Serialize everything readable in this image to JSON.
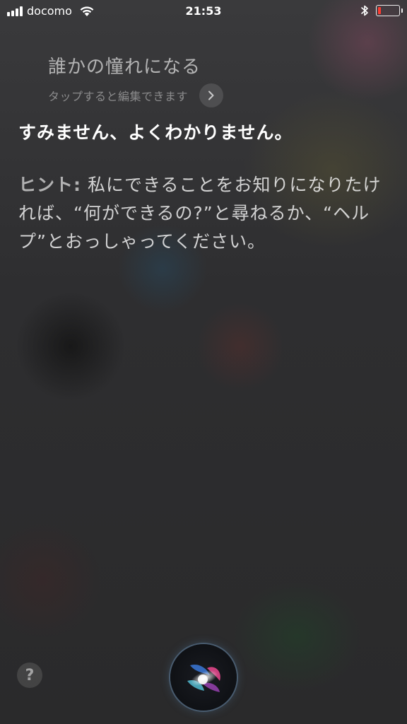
{
  "status_bar": {
    "carrier": "docomo",
    "time": "21:53",
    "battery_level": 0.15
  },
  "siri": {
    "query": "誰かの憧れになる",
    "edit_hint": "タップすると編集できます",
    "response": "すみません、よくわかりません。",
    "hint_label": "ヒント:",
    "hint_text": "私にできることをお知りになりたければ、“何ができるの?”と尋ねるか、“ヘルプ”とおっしゃってください。",
    "help_label": "?"
  },
  "colors": {
    "battery_low": "#ff3b30",
    "orb_pink": "#e0468a",
    "orb_blue": "#3a78d8",
    "orb_cyan": "#5ad0e8"
  },
  "icons": [
    "signal-icon",
    "wifi-icon",
    "bluetooth-icon",
    "battery-icon",
    "chevron-right-icon",
    "siri-orb-icon"
  ]
}
